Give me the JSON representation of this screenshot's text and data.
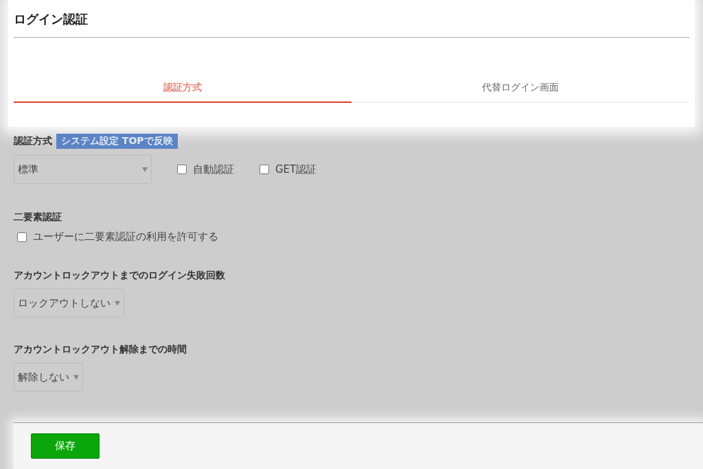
{
  "page": {
    "title": "ログイン認証"
  },
  "tabs": [
    {
      "label": "認証方式",
      "selected": true
    },
    {
      "label": "代替ログイン画面",
      "selected": false
    }
  ],
  "auth_method": {
    "label": "認証方式",
    "badge": "システム設定 TOPで反映",
    "select_value": "標準",
    "options": [
      {
        "label": "自動認証",
        "checked": false
      },
      {
        "label": "GET認証",
        "checked": false
      }
    ]
  },
  "two_factor": {
    "label": "二要素認証",
    "option": {
      "label": "ユーザーに二要素認証の利用を許可する",
      "checked": false
    }
  },
  "lockout_attempts": {
    "label": "アカウントロックアウトまでのログイン失敗回数",
    "select_value": "ロックアウトしない"
  },
  "lockout_release": {
    "label": "アカウントロックアウト解除までの時間",
    "select_value": "解除しない"
  },
  "save_button": "保存"
}
